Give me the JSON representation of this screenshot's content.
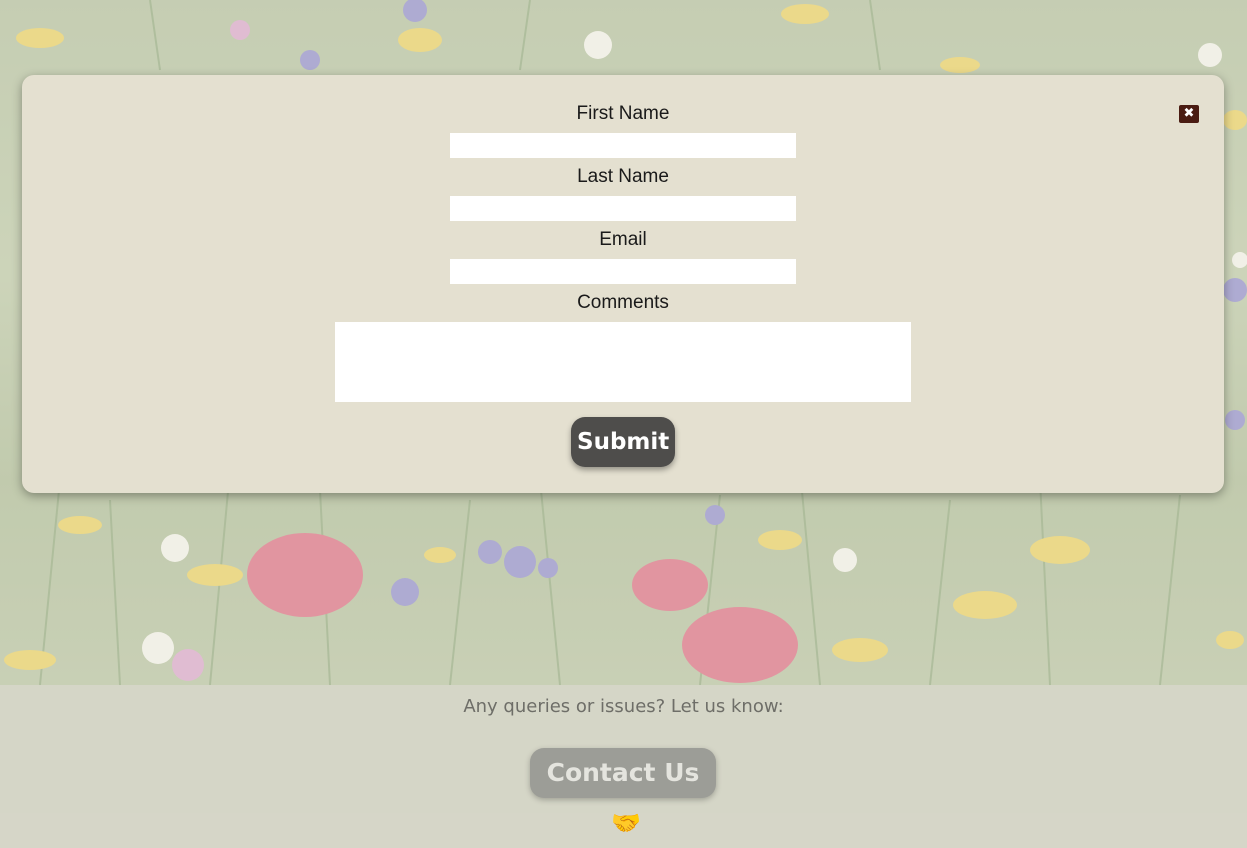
{
  "modal": {
    "close_icon": "close-x-icon",
    "fields": {
      "first_name": {
        "label": "First Name",
        "value": ""
      },
      "last_name": {
        "label": "Last Name",
        "value": ""
      },
      "email": {
        "label": "Email",
        "value": ""
      },
      "comments": {
        "label": "Comments",
        "value": ""
      }
    },
    "submit_label": "Submit"
  },
  "footer": {
    "text": "Any queries or issues? Let us know:",
    "contact_label": "Contact Us",
    "contact_icon": "handshake-icon"
  },
  "colors": {
    "modal_bg": "#e4e0d0",
    "close_button": "#4a1c12",
    "submit_button": "#4e4d4b",
    "footer_bg": "#d5d6c7",
    "contact_button": "#9c9d97"
  }
}
